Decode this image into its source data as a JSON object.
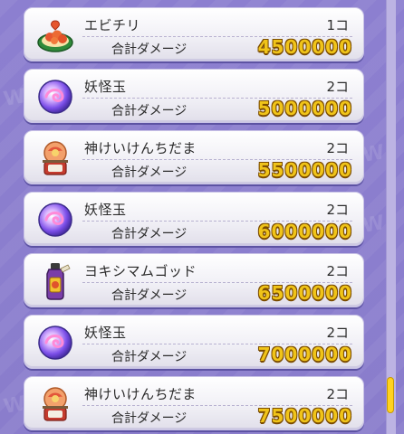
{
  "items": [
    {
      "icon": "shrimp-chili-dish-icon",
      "name": "エビチリ",
      "count": "1コ",
      "damage_label": "合計ダメージ",
      "damage_value": "4500000"
    },
    {
      "icon": "youkai-orb-icon",
      "name": "妖怪玉",
      "count": "2コ",
      "damage_label": "合計ダメージ",
      "damage_value": "5000000"
    },
    {
      "icon": "fortune-daruma-icon",
      "name": "神けいけんちだま",
      "count": "2コ",
      "damage_label": "合計ダメージ",
      "damage_value": "5500000"
    },
    {
      "icon": "youkai-orb-icon",
      "name": "妖怪玉",
      "count": "2コ",
      "damage_label": "合計ダメージ",
      "damage_value": "6000000"
    },
    {
      "icon": "potion-bottle-icon",
      "name": "ヨキシマムゴッド",
      "count": "2コ",
      "damage_label": "合計ダメージ",
      "damage_value": "6500000"
    },
    {
      "icon": "youkai-orb-icon",
      "name": "妖怪玉",
      "count": "2コ",
      "damage_label": "合計ダメージ",
      "damage_value": "7000000"
    },
    {
      "icon": "fortune-daruma-icon",
      "name": "神けいけんちだま",
      "count": "2コ",
      "damage_label": "合計ダメージ",
      "damage_value": "7500000"
    }
  ]
}
